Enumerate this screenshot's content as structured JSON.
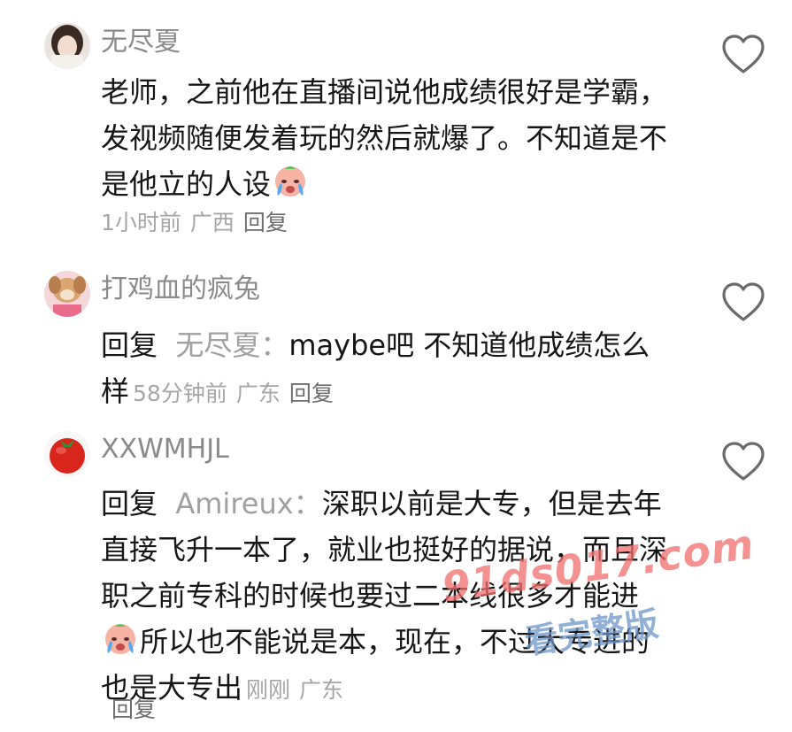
{
  "comments": [
    {
      "username": "无尽夏",
      "text": "老师，之前他在直播间说他成绩很好是学霸，发视频随便发着玩的然后就爆了。不知道是不是他立的人设",
      "emoji": "crying-face-emoji",
      "time": "1小时前",
      "location": "广西",
      "reply_label": "回复",
      "avatar": "girl-avatar",
      "like_icon": "heart-icon"
    },
    {
      "username": "打鸡血的疯兔",
      "reply_prefix": "回复",
      "reply_target": "无尽夏：",
      "text": "maybe吧 不知道他成绩怎么样",
      "time": "58分钟前",
      "location": "广东",
      "reply_label": "回复",
      "avatar": "puppy-avatar",
      "like_icon": "heart-icon"
    },
    {
      "username": "XXWMHJL",
      "reply_prefix": "回复",
      "reply_target": "Amireux：",
      "text_part1": "深职以前是大专，但是去年直接飞升一本了，就业也挺好的据说，而且深职之前专科的时候也要过二本线很多才能进",
      "text_part2": "所以也不能说是本，现在，不过大专进的也是大专出",
      "emoji": "crying-face-emoji",
      "time": "刚刚",
      "location": "广东",
      "reply_label": "回复",
      "avatar": "tomato-avatar",
      "like_icon": "heart-icon"
    }
  ],
  "watermark": {
    "line1": "91ds017.com",
    "line2": "看完整版",
    "color": "#f07b7b"
  }
}
